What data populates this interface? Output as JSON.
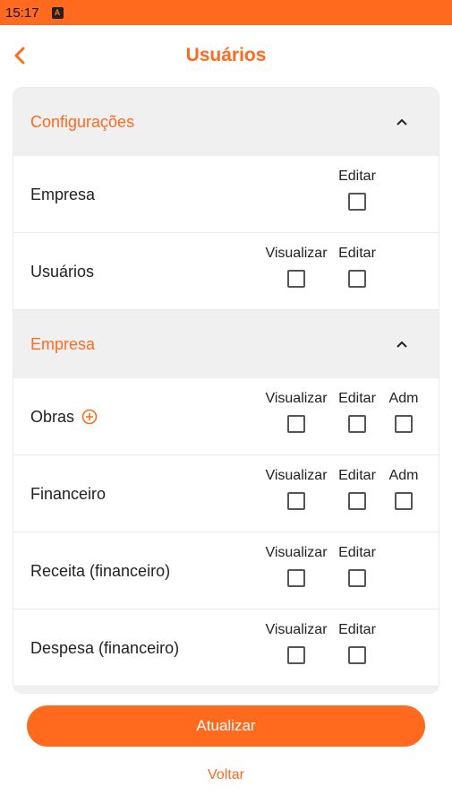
{
  "status_bar": {
    "time": "15:17",
    "notification_icon": "A"
  },
  "header": {
    "title": "Usuários",
    "back_icon": "chevron-left-icon"
  },
  "sections": [
    {
      "title": "Configurações",
      "expanded": true,
      "rows": [
        {
          "label": "Empresa",
          "columns": [
            "Editar"
          ]
        },
        {
          "label": "Usuários",
          "columns": [
            "Visualizar",
            "Editar"
          ]
        }
      ]
    },
    {
      "title": "Empresa",
      "expanded": true,
      "rows": [
        {
          "label": "Obras",
          "has_add_icon": true,
          "columns": [
            "Visualizar",
            "Editar",
            "Adm"
          ]
        },
        {
          "label": "Financeiro",
          "columns": [
            "Visualizar",
            "Editar",
            "Adm"
          ]
        },
        {
          "label": "Receita (financeiro)",
          "columns": [
            "Visualizar",
            "Editar"
          ]
        },
        {
          "label": "Despesa (financeiro)",
          "columns": [
            "Visualizar",
            "Editar"
          ]
        }
      ]
    }
  ],
  "actions": {
    "update_label": "Atualizar",
    "back_label": "Voltar"
  },
  "colors": {
    "accent": "#ff6a1f",
    "section_bg": "#f0f0f0"
  }
}
